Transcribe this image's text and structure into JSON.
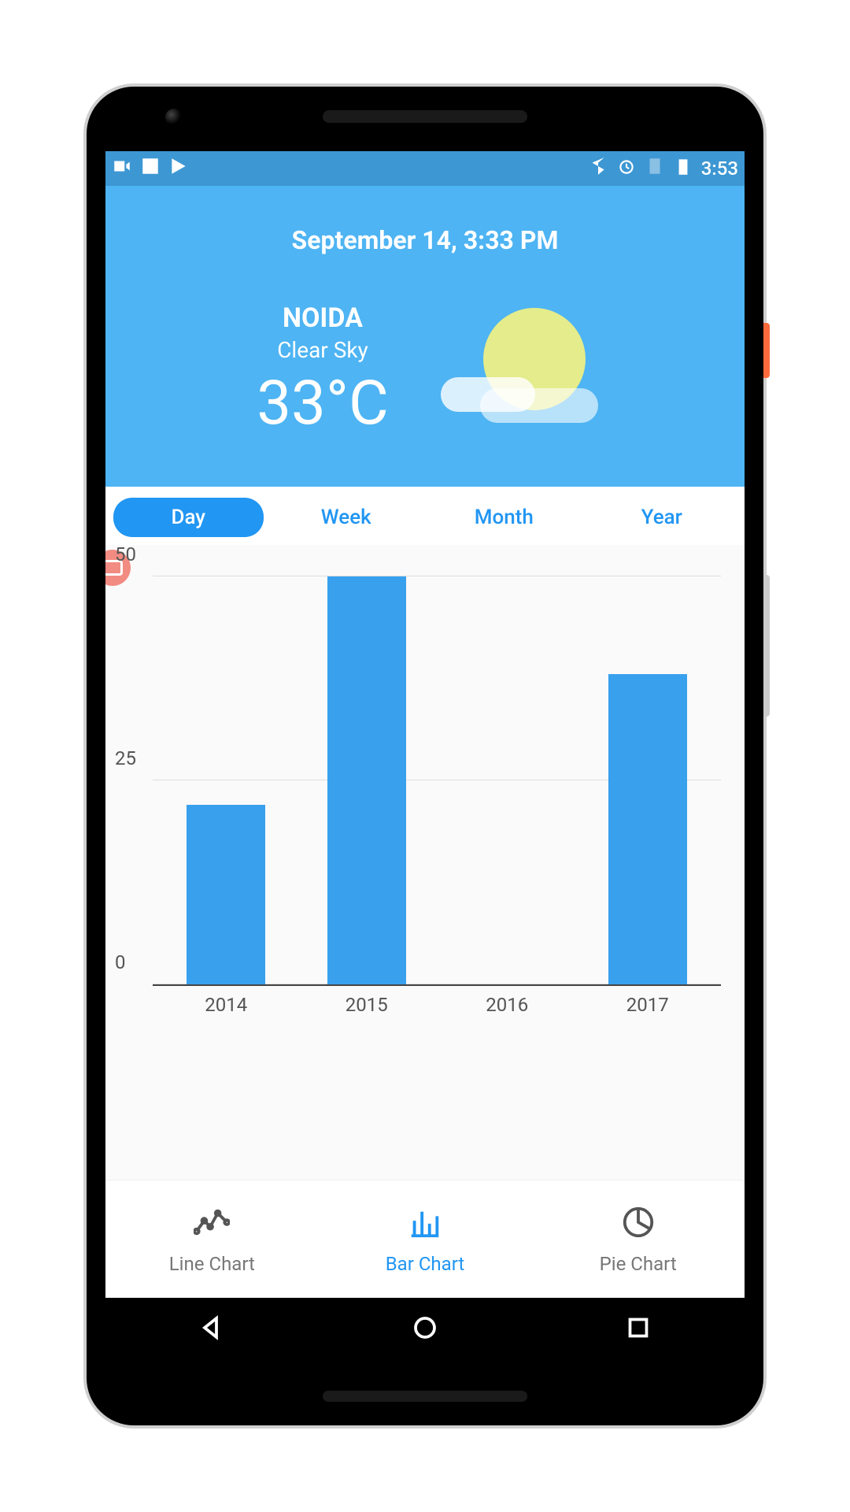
{
  "statusbar": {
    "time": "3:53"
  },
  "weather": {
    "date": "September 14, 3:33 PM",
    "location": "NOIDA",
    "condition": "Clear Sky",
    "temperature": "33°C"
  },
  "range_tabs": {
    "items": [
      "Day",
      "Week",
      "Month",
      "Year"
    ],
    "active": 0
  },
  "bottom_tabs": {
    "items": [
      "Line Chart",
      "Bar Chart",
      "Pie Chart"
    ],
    "active": 1
  },
  "chart_data": {
    "type": "bar",
    "categories": [
      "2014",
      "2015",
      "2016",
      "2017"
    ],
    "values": [
      22,
      50,
      0,
      38
    ],
    "ylim": [
      0,
      50
    ],
    "yticks": [
      0,
      25,
      50
    ],
    "title": "",
    "xlabel": "",
    "ylabel": ""
  }
}
